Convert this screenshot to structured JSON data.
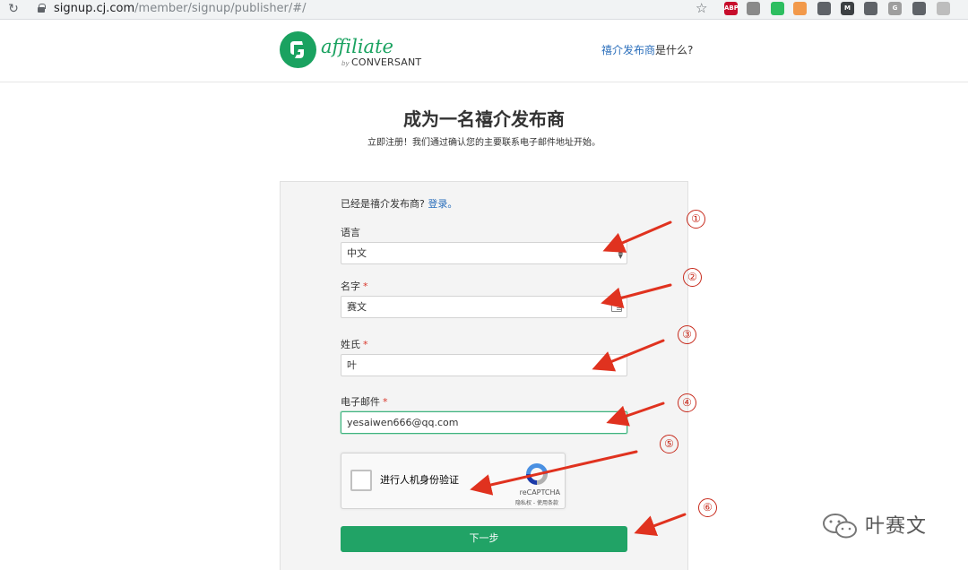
{
  "browser": {
    "url_host": "signup.cj.com",
    "url_path": "/member/signup/publisher/#/",
    "extensions": [
      {
        "name": "abp-icon",
        "text": "ABP",
        "color": "#c70d2c"
      },
      {
        "name": "extension-icon-2",
        "text": "",
        "color": "#8a8a8a"
      },
      {
        "name": "evernote-icon",
        "text": "",
        "color": "#2dbe60"
      },
      {
        "name": "extension-icon-4",
        "text": "",
        "color": "#f2994a"
      },
      {
        "name": "camera-icon",
        "text": "",
        "color": "#5f6368"
      },
      {
        "name": "gmail-icon",
        "text": "M",
        "color": "#3c4043"
      },
      {
        "name": "extension-icon-7",
        "text": "",
        "color": "#5f6368"
      },
      {
        "name": "grammarly-icon",
        "text": "G",
        "color": "#9e9e9e"
      },
      {
        "name": "robot-icon",
        "text": "",
        "color": "#5f6368"
      },
      {
        "name": "extension-icon-10",
        "text": "",
        "color": "#bdbdbd"
      }
    ]
  },
  "header": {
    "logo_word": "affiliate",
    "logo_by": "by",
    "logo_brand": "CONVERSANT",
    "help_link": "禧介发布商",
    "help_suffix": "是什么?"
  },
  "title": "成为一名禧介发布商",
  "subtitle": "立即注册！我们通过确认您的主要联系电子邮件地址开始。",
  "form": {
    "already_text": "已经是禧介发布商?",
    "login_link": "登录。",
    "language_label": "语言",
    "language_value": "中文",
    "first_name_label": "名字",
    "first_name_value": "赛文",
    "last_name_label": "姓氏",
    "last_name_value": "叶",
    "email_label": "电子邮件",
    "email_value": "yesaiwen666@qq.com",
    "required_mark": "*",
    "captcha_label": "进行人机身份验证",
    "captcha_brand": "reCAPTCHA",
    "captcha_terms": "隐私权 - 使用条款",
    "next_button": "下一步"
  },
  "annotations": [
    "①",
    "②",
    "③",
    "④",
    "⑤",
    "⑥"
  ],
  "watermark": "叶赛文",
  "colors": {
    "brand_green": "#1aa260",
    "button_green": "#21a366",
    "link_blue": "#2a6ebb",
    "annotation_red": "#e0321f"
  }
}
